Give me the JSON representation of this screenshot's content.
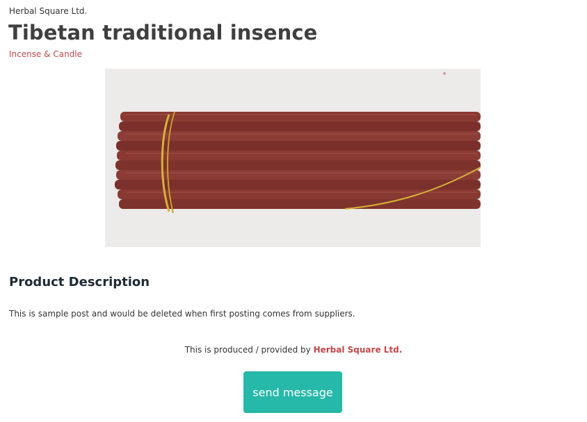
{
  "product": {
    "supplier": "Herbal Square Ltd.",
    "title": "Tibetan traditional insence",
    "category": "Incense & Candle",
    "image_icon": "incense-sticks-image"
  },
  "description": {
    "heading": "Product Description",
    "text": "This is sample post and would be deleted when first posting comes from suppliers."
  },
  "provider": {
    "prefix": "This is produced / provided by ",
    "name": "Herbal Square Ltd."
  },
  "actions": {
    "send_label": "send message"
  },
  "colors": {
    "accent": "#26b8a8",
    "link": "#c2484a"
  }
}
